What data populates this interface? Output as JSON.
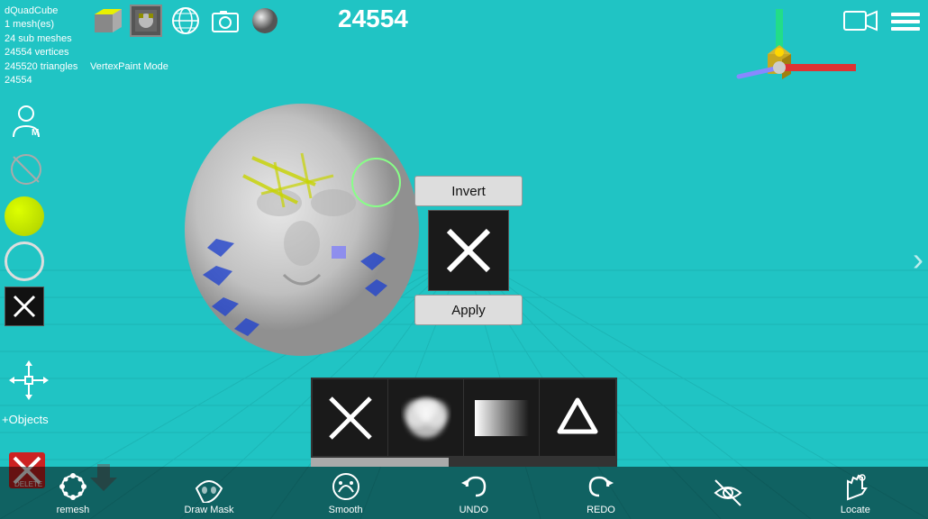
{
  "app": {
    "title": "dQuadCube",
    "mesh_count": "1 mesh(es)",
    "sub_meshes": "24 sub meshes",
    "vertices": "24554 vertices",
    "triangles": "245520 triangles",
    "count": "24554",
    "vertex_paint_label": "VertexPaint   Mode"
  },
  "obj_count": {
    "value": "24554"
  },
  "invert_panel": {
    "invert_label": "Invert",
    "apply_label": "Apply"
  },
  "bottom_toolbar": {
    "remesh_label": "remesh",
    "draw_mask_label": "Draw Mask",
    "smooth_label": "Smooth",
    "undo_label": "UNDO",
    "redo_label": "REDO",
    "locate_label": "Locate"
  },
  "brushes": [
    {
      "name": "x-brush",
      "type": "x"
    },
    {
      "name": "cloud-brush",
      "type": "cloud"
    },
    {
      "name": "gradient-brush",
      "type": "gradient"
    },
    {
      "name": "up-brush",
      "type": "up"
    }
  ],
  "progress": {
    "value": 45,
    "max": 100
  },
  "colors": {
    "bg": "#20c4c4",
    "toolbar_bg": "rgba(0,0,0,0.5)",
    "panel_btn": "#ddd",
    "black_box": "#1a1a1a"
  }
}
